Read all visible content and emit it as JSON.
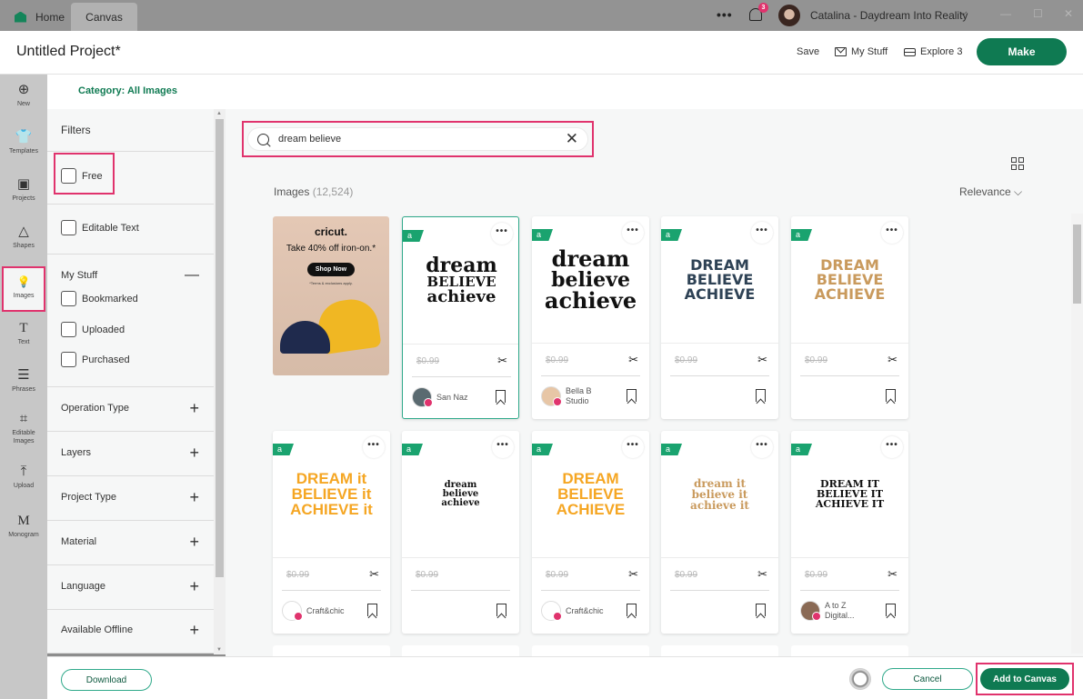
{
  "titlebar": {
    "tabs": [
      {
        "label": "Home"
      },
      {
        "label": "Canvas"
      }
    ],
    "more_label": "•••",
    "notification_count": "3",
    "user_name": "Catalina - Daydream Into Reality",
    "window_controls": {
      "minimize": "—",
      "maximize": "☐",
      "close": "✕"
    }
  },
  "header": {
    "project_title": "Untitled Project*",
    "save_label": "Save",
    "my_stuff_label": "My Stuff",
    "explore_label": "Explore 3",
    "make_label": "Make"
  },
  "rail": {
    "items": [
      {
        "label": "New",
        "icon": "⊕"
      },
      {
        "label": "Templates",
        "icon": "👕"
      },
      {
        "label": "Projects",
        "icon": "▣"
      },
      {
        "label": "Shapes",
        "icon": "△"
      },
      {
        "label": "Images",
        "icon": "💡"
      },
      {
        "label": "Text",
        "icon": "T"
      },
      {
        "label": "Phrases",
        "icon": "☰"
      },
      {
        "label": "Editable Images",
        "icon": "⌗"
      },
      {
        "label": "Upload",
        "icon": "⤒"
      },
      {
        "label": "Monogram",
        "icon": "M"
      }
    ]
  },
  "filters": {
    "category": "Category: All Images",
    "title": "Filters",
    "free_label": "Free",
    "editable_text_label": "Editable Text",
    "my_stuff": {
      "title": "My Stuff",
      "toggle": "—",
      "options": [
        "Bookmarked",
        "Uploaded",
        "Purchased"
      ]
    },
    "sections": [
      "Operation Type",
      "Layers",
      "Project Type",
      "Material",
      "Language",
      "Available Offline"
    ],
    "expand_glyph": "+"
  },
  "search": {
    "value": "dream believe",
    "clear_glyph": "✕"
  },
  "results": {
    "label": "Images",
    "count": "(12,524)",
    "sort": "Relevance ⌵"
  },
  "ad": {
    "brand": "cricut.",
    "headline": "Take 40% off iron-on.*",
    "button": "Shop Now",
    "terms": "*Terms & exclusions apply."
  },
  "cards": [
    {
      "art": [
        "dream",
        "BELIEVE",
        "achieve"
      ],
      "price": "$0.99",
      "author": "San Naz",
      "flag": "a"
    },
    {
      "art": [
        "dream",
        "believe",
        "achieve"
      ],
      "price": "$0.99",
      "author": "Bella B Studio",
      "flag": "a"
    },
    {
      "art": [
        "DREAM",
        "BELIEVE",
        "ACHIEVE"
      ],
      "price": "$0.99",
      "author": "",
      "flag": "a"
    },
    {
      "art": [
        "DREAM",
        "BELIEVE",
        "ACHIEVE"
      ],
      "price": "$0.99",
      "author": "",
      "flag": "a"
    },
    {
      "art": [
        "DREAM it",
        "BELIEVE it",
        "ACHIEVE it"
      ],
      "price": "$0.99",
      "author": "Craft&chic",
      "flag": "a"
    },
    {
      "art": [
        "dream",
        "believe",
        "achieve"
      ],
      "price": "$0.99",
      "author": "",
      "flag": "a"
    },
    {
      "art": [
        "DREAM",
        "BELIEVE",
        "ACHIEVE"
      ],
      "price": "$0.99",
      "author": "Craft&chic",
      "flag": "a"
    },
    {
      "art": [
        "dream it",
        "believe it",
        "achieve it"
      ],
      "price": "$0.99",
      "author": "",
      "flag": "a"
    },
    {
      "art": [
        "DREAM IT",
        "BELIEVE IT",
        "ACHIEVE IT"
      ],
      "price": "$0.99",
      "author": "A to Z Digital...",
      "flag": "a"
    }
  ],
  "card_more": "•••",
  "card_cut": "✂",
  "footer": {
    "download_label": "Download",
    "cancel_label": "Cancel",
    "add_label": "Add to Canvas"
  },
  "colors": {
    "brand_green": "#0f7a52",
    "highlight_pink": "#e0336d",
    "flag_green": "#1aa36f"
  }
}
